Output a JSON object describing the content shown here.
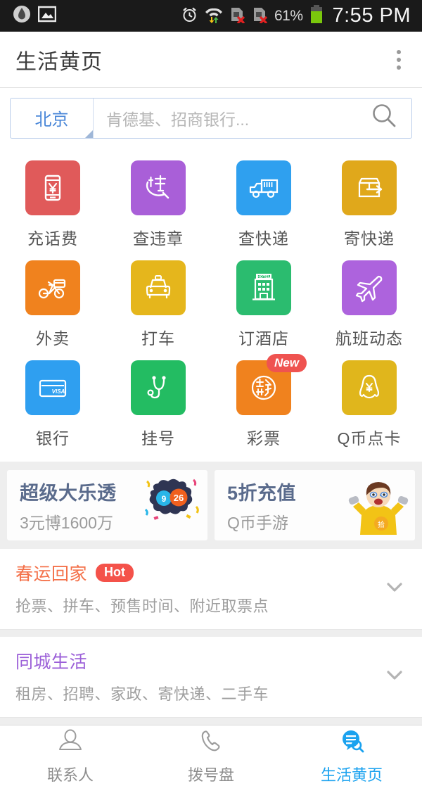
{
  "statusbar": {
    "left_icons": [
      "droplet-icon",
      "photo-icon"
    ],
    "right_icons": [
      "alarm-icon",
      "wifi-icon",
      "sim1-no-service-icon",
      "sim2-no-service-icon",
      "battery-icon"
    ],
    "battery_percent": "61%",
    "time": "7:55 PM"
  },
  "header": {
    "title": "生活黄页",
    "overflow_menu": "overflow-menu"
  },
  "search": {
    "city": "北京",
    "placeholder": "肯德基、招商银行...",
    "button": "search-icon"
  },
  "grid": {
    "items": [
      {
        "label": "充话费",
        "icon": "phone-yuan-icon",
        "color": "#e05a5a"
      },
      {
        "label": "查违章",
        "icon": "violation-search-icon",
        "color": "#a95fd8"
      },
      {
        "label": "查快递",
        "icon": "delivery-truck-icon",
        "color": "#2fa0ef"
      },
      {
        "label": "寄快递",
        "icon": "send-parcel-icon",
        "color": "#e0a81b"
      },
      {
        "label": "外卖",
        "icon": "scooter-icon",
        "color": "#f0821e"
      },
      {
        "label": "打车",
        "icon": "taxi-icon",
        "color": "#e5b61c"
      },
      {
        "label": "订酒店",
        "icon": "hotel-icon",
        "color": "#2bbc6f"
      },
      {
        "label": "航班动态",
        "icon": "airplane-icon",
        "color": "#ad63dd"
      },
      {
        "label": "银行",
        "icon": "credit-card-icon",
        "color": "#2f9ff0"
      },
      {
        "label": "挂号",
        "icon": "stethoscope-icon",
        "color": "#23bc62"
      },
      {
        "label": "彩票",
        "icon": "lottery-icon",
        "color": "#f0821e",
        "badge": "New"
      },
      {
        "label": "Q币点卡",
        "icon": "qq-penguin-yuan-icon",
        "color": "#e0b61c"
      }
    ]
  },
  "banners": [
    {
      "title": "超级大乐透",
      "subtitle": "3元博1600万",
      "art": "lottery-balls-art",
      "ball_left": "9",
      "ball_right": "26"
    },
    {
      "title": "5折充值",
      "subtitle": "Q币手游",
      "art": "gamer-boy-art"
    }
  ],
  "list": [
    {
      "title": "春运回家",
      "title_color": "#f4714a",
      "badge": "Hot",
      "subtitle": "抢票、拼车、预售时间、附近取票点",
      "chevron": "chevron-down-icon"
    },
    {
      "title": "同城生活",
      "title_color": "#9b5fd8",
      "badge": null,
      "subtitle": "租房、招聘、家政、寄快递、二手车",
      "chevron": "chevron-down-icon"
    }
  ],
  "bottomnav": {
    "items": [
      {
        "label": "联系人",
        "icon": "contacts-person-icon",
        "active": false
      },
      {
        "label": "拨号盘",
        "icon": "dialpad-phone-icon",
        "active": false
      },
      {
        "label": "生活黄页",
        "icon": "yellowpages-icon",
        "active": true
      }
    ],
    "accent": "#1ba2ef"
  }
}
